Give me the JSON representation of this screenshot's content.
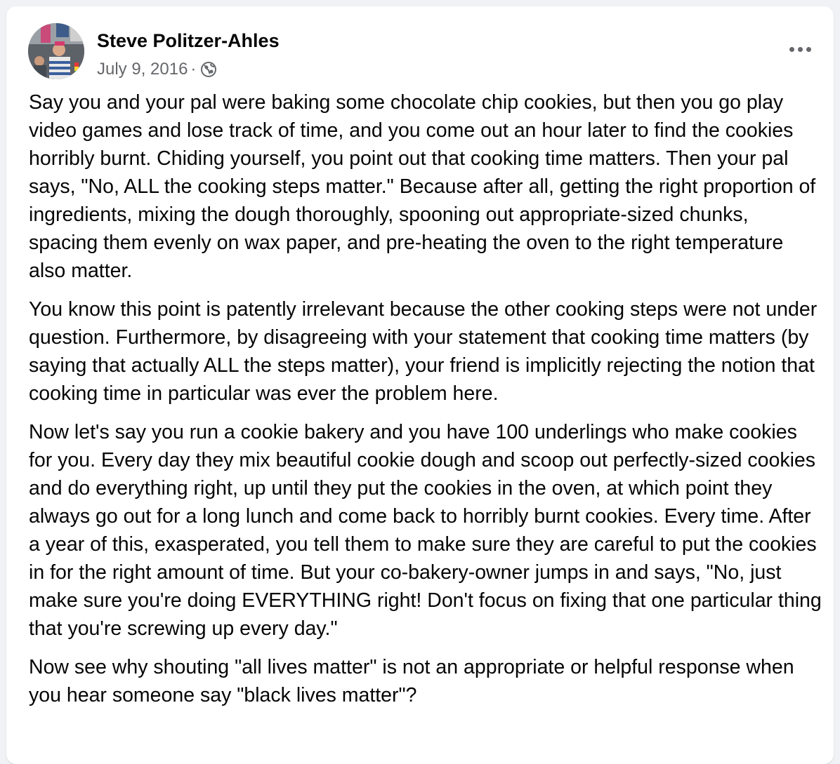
{
  "post": {
    "author": "Steve Politzer-Ahles",
    "date": "July 9, 2016",
    "separator": "·",
    "privacy_icon": "globe-icon",
    "more_icon": "more-options-icon",
    "paragraphs": [
      "Say you and your pal were baking some chocolate chip cookies, but then you go play video games and lose track of time, and you come out an hour later to find the cookies horribly burnt. Chiding yourself, you point out that cooking time matters. Then your pal says, \"No, ALL the cooking steps matter.\" Because after all, getting the right proportion of ingredients, mixing the dough thoroughly, spooning out appropriate-sized chunks, spacing them evenly on wax paper, and pre-heating the oven to the right temperature also matter.",
      "You know this point is patently irrelevant because the other cooking steps were not under question. Furthermore, by disagreeing with your statement that cooking time matters (by saying that actually ALL the steps matter), your friend is implicitly rejecting the notion that cooking time in particular was ever the problem here.",
      "Now let's say you run a cookie bakery and you have 100 underlings who make cookies for you. Every day they mix beautiful cookie dough and scoop out perfectly-sized cookies and do everything right, up until they put the cookies in the oven, at which point they always go out for a long lunch and come back to horribly burnt cookies. Every time. After a year of this, exasperated, you tell them to make sure they are careful to put the cookies in for the right amount of time. But your co-bakery-owner jumps in and says, \"No, just make sure you're doing EVERYTHING right! Don't focus on fixing that one particular thing that you're screwing up every day.\"",
      "Now see why shouting \"all lives matter\" is not an appropriate or helpful response when you hear someone say \"black lives matter\"?"
    ]
  },
  "colors": {
    "page_background": "#f0f2f5",
    "card_background": "#ffffff",
    "text_primary": "#050505",
    "text_secondary": "#65676b"
  }
}
